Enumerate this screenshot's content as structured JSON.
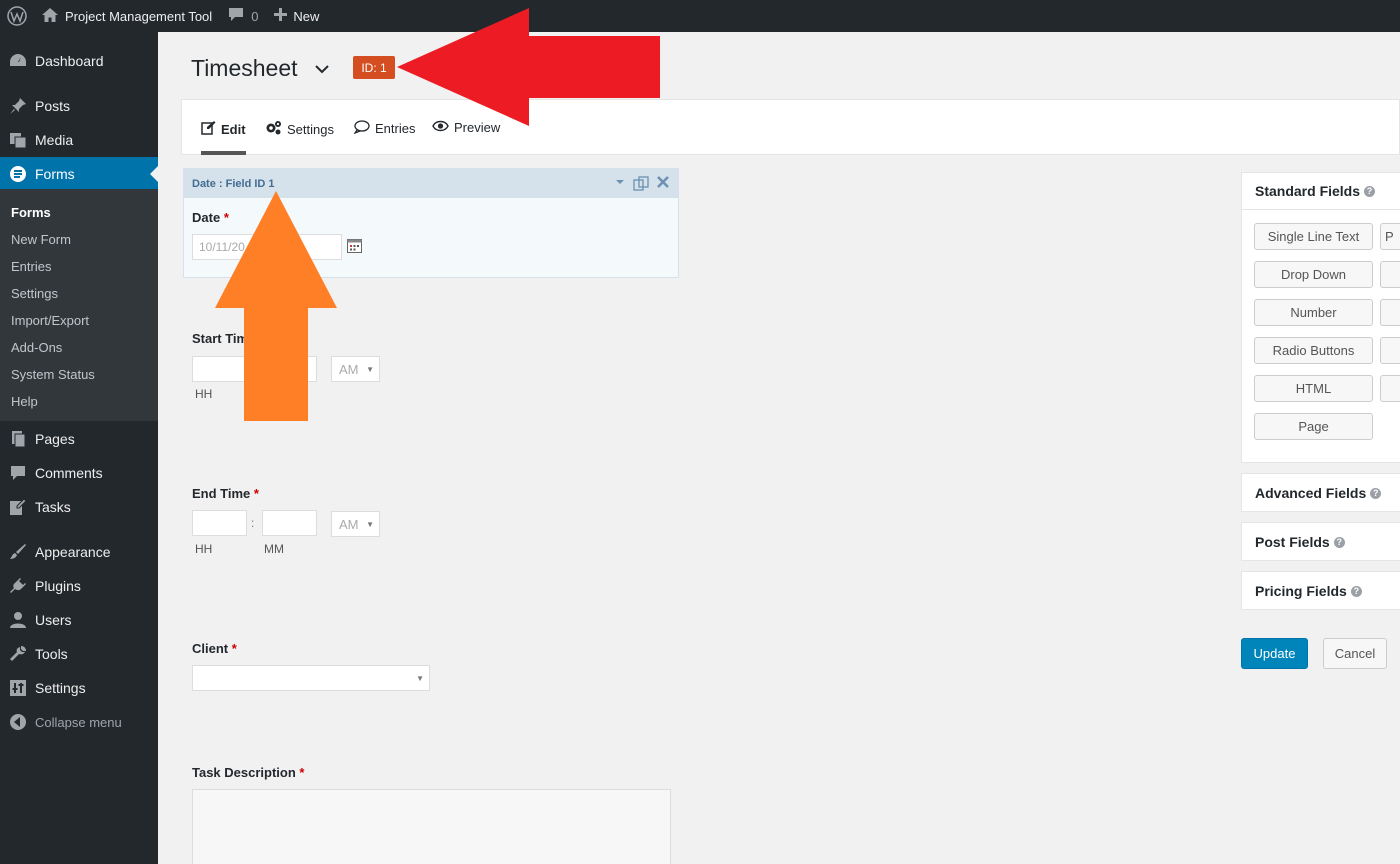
{
  "admin_bar": {
    "site_name": "Project Management Tool",
    "comments_count": "0",
    "new_label": "New"
  },
  "sidebar": {
    "items": [
      {
        "label": "Dashboard",
        "icon": "dashboard-icon"
      },
      {
        "label": "Posts",
        "icon": "pin-icon"
      },
      {
        "label": "Media",
        "icon": "media-icon"
      },
      {
        "label": "Forms",
        "icon": "forms-icon"
      },
      {
        "label": "Pages",
        "icon": "pages-icon"
      },
      {
        "label": "Comments",
        "icon": "comment-icon"
      },
      {
        "label": "Tasks",
        "icon": "edit-icon"
      },
      {
        "label": "Appearance",
        "icon": "brush-icon"
      },
      {
        "label": "Plugins",
        "icon": "plug-icon"
      },
      {
        "label": "Users",
        "icon": "user-icon"
      },
      {
        "label": "Tools",
        "icon": "wrench-icon"
      },
      {
        "label": "Settings",
        "icon": "sliders-icon"
      }
    ],
    "collapse_label": "Collapse menu",
    "submenu": [
      "Forms",
      "New Form",
      "Entries",
      "Settings",
      "Import/Export",
      "Add-Ons",
      "System Status",
      "Help"
    ]
  },
  "header": {
    "title": "Timesheet",
    "id_badge": "ID: 1"
  },
  "toolbar": {
    "tabs": [
      "Edit",
      "Settings",
      "Entries",
      "Preview"
    ]
  },
  "fields": {
    "date_header": "Date : Field ID 1",
    "date_label": "Date",
    "date_placeholder": "10/11/20",
    "start_time_label": "Start Tim",
    "end_time_label": "End Time",
    "ampm": "AM",
    "hh": "HH",
    "mm": "MM",
    "colon": ":",
    "client_label": "Client",
    "task_label": "Task Description",
    "required": "*"
  },
  "panels": {
    "standard": "Standard Fields",
    "advanced": "Advanced Fields",
    "post": "Post Fields",
    "pricing": "Pricing Fields",
    "buttons": [
      "Single Line Text",
      "Drop Down",
      "Number",
      "Radio Buttons",
      "HTML",
      "Page"
    ],
    "partial_buttons": [
      "P"
    ]
  },
  "actions": {
    "update": "Update",
    "cancel": "Cancel"
  },
  "colors": {
    "admin_bar": "#23282d",
    "active_menu": "#0073aa",
    "badge": "#d54e21",
    "annotation_red": "#ed1c24",
    "annotation_orange": "#ff7f27"
  }
}
